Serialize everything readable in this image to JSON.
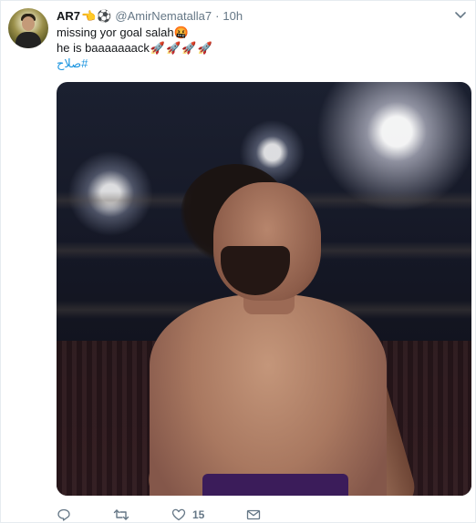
{
  "tweet": {
    "display_name": "AR7",
    "name_emojis": [
      "backhand-index-pointing-left-emoji",
      "soccer-ball-emoji"
    ],
    "handle": "@AmirNematalla7",
    "separator": "·",
    "time": "10h",
    "lines": [
      {
        "text": "missing yor goal salah",
        "emoji": "face-with-symbols-emoji"
      },
      {
        "text": "he is baaaaaaack",
        "emoji": "rocket-emoji-x4"
      }
    ],
    "hashtag": "#صلاح",
    "media": {
      "description_icon": "photo"
    }
  },
  "actions": {
    "reply": {
      "icon": "reply-icon",
      "count": ""
    },
    "retweet": {
      "icon": "retweet-icon",
      "count": ""
    },
    "like": {
      "icon": "heart-icon",
      "count": "15"
    },
    "dm": {
      "icon": "envelope-icon",
      "count": ""
    }
  },
  "colors": {
    "link": "#1b95e0",
    "secondary_text": "#657786",
    "primary_text": "#14171a"
  }
}
